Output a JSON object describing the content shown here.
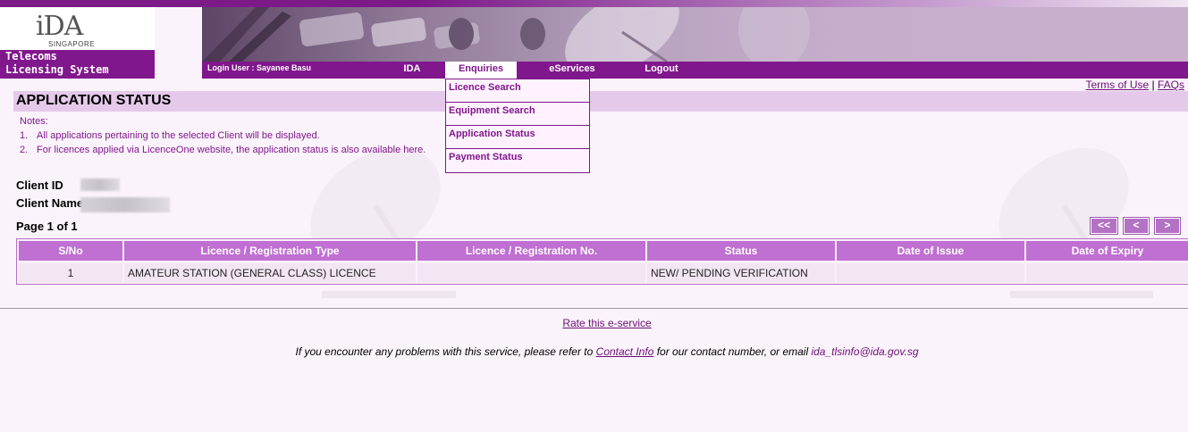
{
  "brand": {
    "logo": "iDA",
    "logo_sub": "SINGAPORE",
    "system_line1": "Telecoms",
    "system_line2": "Licensing System"
  },
  "nav": {
    "login_user": "Login User : Sayanee Basu",
    "items": [
      "IDA",
      "Enquiries",
      "eServices",
      "Logout"
    ],
    "active": "Enquiries"
  },
  "dropdown": {
    "items": [
      "Licence Search",
      "Equipment Search",
      "Application Status",
      "Payment Status"
    ]
  },
  "top_links": {
    "terms": "Terms of Use",
    "separator": "|",
    "faqs": "FAQs"
  },
  "page": {
    "title": "APPLICATION STATUS",
    "notes_heading": "Notes:",
    "notes": [
      {
        "num": "1.",
        "text": "All applications pertaining to the selected Client will be displayed."
      },
      {
        "num": "2.",
        "text": "For licences applied via LicenceOne website, the application status is also available here."
      }
    ],
    "client_id_label": "Client ID",
    "client_name_label": "Client Name",
    "page_info": "Page 1 of 1"
  },
  "pager": {
    "first": "<<",
    "prev": "<",
    "next": ">"
  },
  "table": {
    "headers": [
      "S/No",
      "Licence / Registration Type",
      "Licence / Registration No.",
      "Status",
      "Date of Issue",
      "Date of Expiry"
    ],
    "rows": [
      [
        "1",
        "AMATEUR STATION (GENERAL CLASS) LICENCE",
        "",
        "NEW/ PENDING VERIFICATION",
        "",
        ""
      ]
    ]
  },
  "footer": {
    "rate_link": "Rate this e-service",
    "text_before": "If you encounter any problems with this service, please refer to ",
    "contact_link": "Contact Info",
    "text_after": " for our contact number, or email ",
    "email": "ida_tlsinfo@ida.gov.sg"
  },
  "colors": {
    "brand_purple": "#80178c",
    "header_cell": "#c06fd2",
    "title_bar": "#e5c9ea"
  }
}
